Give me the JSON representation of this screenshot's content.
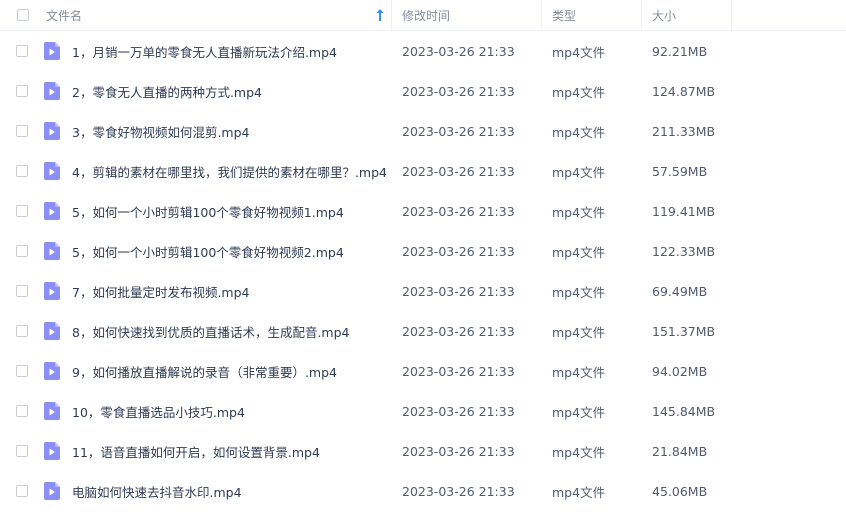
{
  "header": {
    "name_label": "文件名",
    "time_label": "修改时间",
    "type_label": "类型",
    "size_label": "大小"
  },
  "colors": {
    "icon_accent": "#7f83f2",
    "sort_arrow": "#3b8cff"
  },
  "files": [
    {
      "name": "1，月销一万单的零食无人直播新玩法介绍.mp4",
      "time": "2023-03-26 21:33",
      "type": "mp4文件",
      "size": "92.21MB"
    },
    {
      "name": "2，零食无人直播的两种方式.mp4",
      "time": "2023-03-26 21:33",
      "type": "mp4文件",
      "size": "124.87MB"
    },
    {
      "name": "3，零食好物视频如何混剪.mp4",
      "time": "2023-03-26 21:33",
      "type": "mp4文件",
      "size": "211.33MB"
    },
    {
      "name": "4，剪辑的素材在哪里找，我们提供的素材在哪里？.mp4",
      "time": "2023-03-26 21:33",
      "type": "mp4文件",
      "size": "57.59MB"
    },
    {
      "name": "5，如何一个小时剪辑100个零食好物视频1.mp4",
      "time": "2023-03-26 21:33",
      "type": "mp4文件",
      "size": "119.41MB"
    },
    {
      "name": "5，如何一个小时剪辑100个零食好物视频2.mp4",
      "time": "2023-03-26 21:33",
      "type": "mp4文件",
      "size": "122.33MB"
    },
    {
      "name": "7，如何批量定时发布视频.mp4",
      "time": "2023-03-26 21:33",
      "type": "mp4文件",
      "size": "69.49MB"
    },
    {
      "name": "8，如何快速找到优质的直播话术，生成配音.mp4",
      "time": "2023-03-26 21:33",
      "type": "mp4文件",
      "size": "151.37MB"
    },
    {
      "name": "9，如何播放直播解说的录音（非常重要）.mp4",
      "time": "2023-03-26 21:33",
      "type": "mp4文件",
      "size": "94.02MB"
    },
    {
      "name": "10，零食直播选品小技巧.mp4",
      "time": "2023-03-26 21:33",
      "type": "mp4文件",
      "size": "145.84MB"
    },
    {
      "name": "11，语音直播如何开启，如何设置背景.mp4",
      "time": "2023-03-26 21:33",
      "type": "mp4文件",
      "size": "21.84MB"
    },
    {
      "name": "电脑如何快速去抖音水印.mp4",
      "time": "2023-03-26 21:33",
      "type": "mp4文件",
      "size": "45.06MB"
    }
  ]
}
